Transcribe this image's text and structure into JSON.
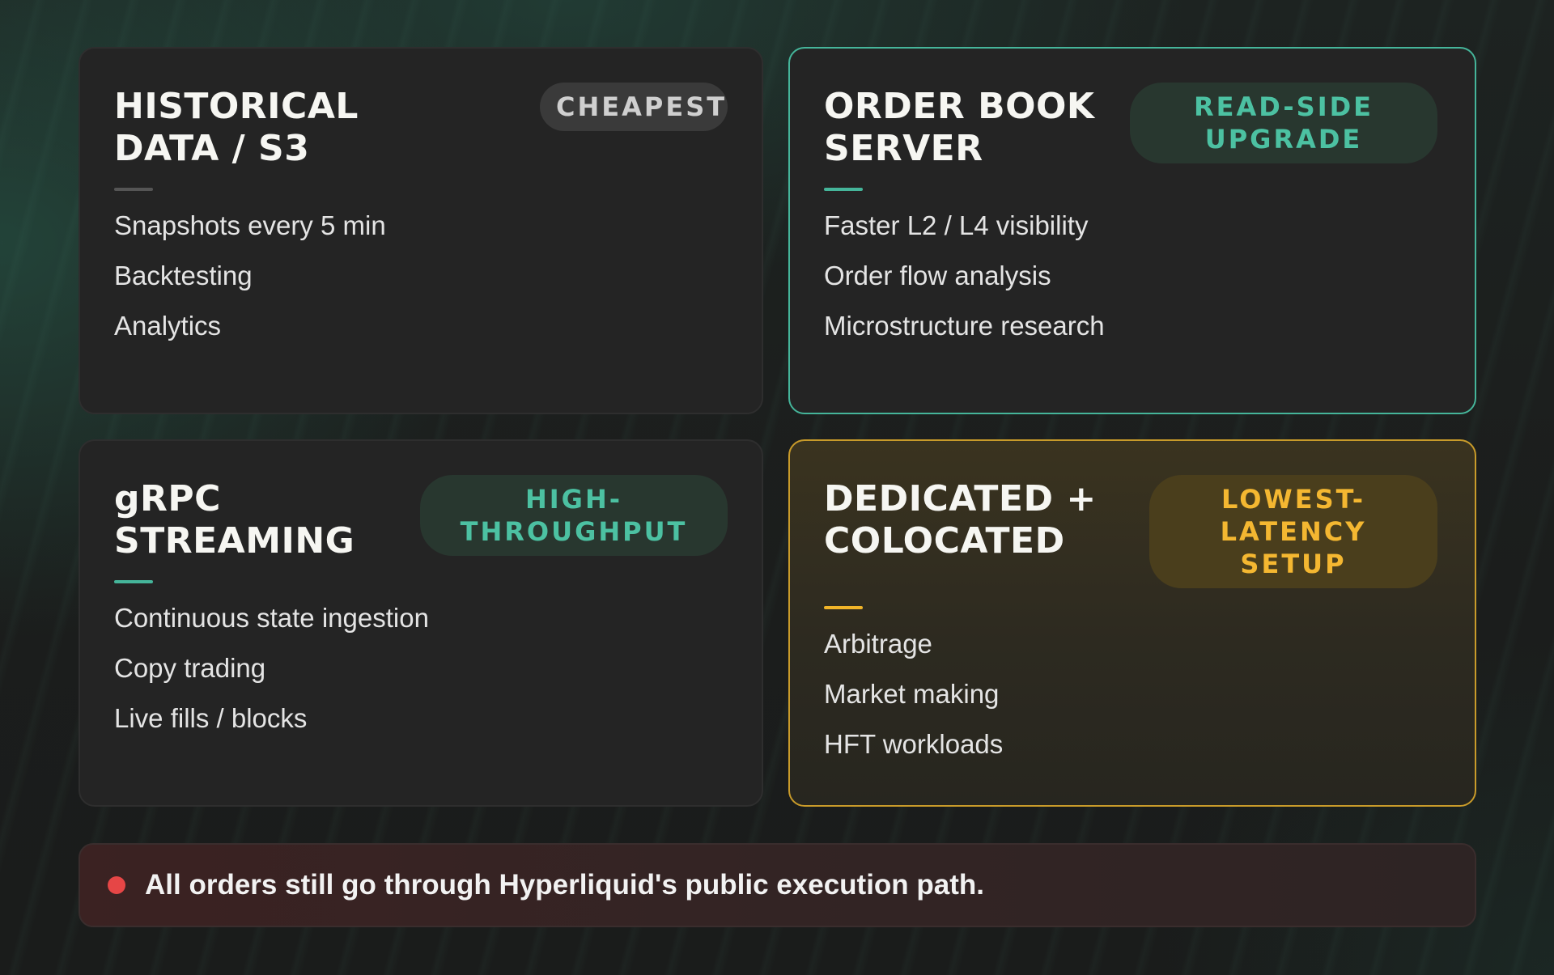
{
  "cards": [
    {
      "title": "HISTORICAL\nDATA / S3",
      "badge": "CHEAPEST",
      "items": [
        "Snapshots every 5 min",
        "Backtesting",
        "Analytics"
      ]
    },
    {
      "title": "ORDER BOOK\nSERVER",
      "badge": "READ-SIDE\nUPGRADE",
      "items": [
        "Faster L2 / L4 visibility",
        "Order flow analysis",
        "Microstructure research"
      ]
    },
    {
      "title": "gRPC\nSTREAMING",
      "badge": "HIGH-\nTHROUGHPUT",
      "items": [
        "Continuous state ingestion",
        "Copy trading",
        "Live fills / blocks"
      ]
    },
    {
      "title": "DEDICATED +\nCOLOCATED",
      "badge": "LOWEST-\nLATENCY SETUP",
      "items": [
        "Arbitrage",
        "Market making",
        "HFT workloads"
      ]
    }
  ],
  "note": {
    "text": "All orders still go through Hyperliquid's public execution path.",
    "icon": "red-dot-icon"
  },
  "colors": {
    "teal_accent": "#45b59a",
    "gold_accent": "#f0b429",
    "alert_red": "#e64646"
  }
}
